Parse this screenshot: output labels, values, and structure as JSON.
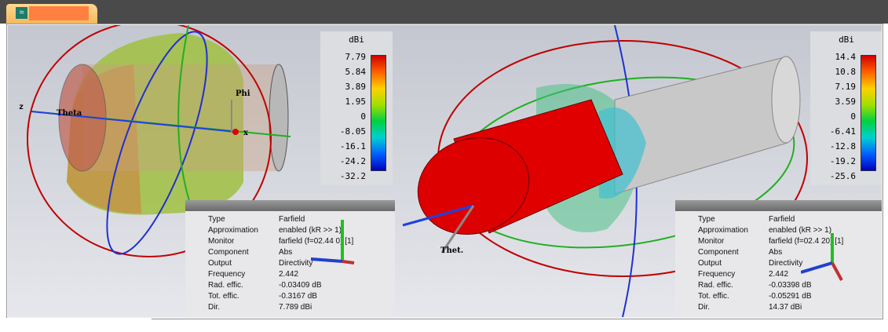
{
  "tab": {
    "icon": "wave-icon"
  },
  "views": [
    {
      "colorbar": {
        "unit": "dBi",
        "ticks": [
          "7.79",
          "5.84",
          "3.89",
          "1.95",
          "0",
          "-8.05",
          "-16.1",
          "-24.2",
          "-32.2"
        ]
      },
      "axis_labels": {
        "theta": "Theta",
        "phi": "Phi",
        "z": "z",
        "x": "x"
      },
      "info": [
        [
          "Type",
          "Farfield"
        ],
        [
          "Approximation",
          "enabled (kR >> 1)"
        ],
        [
          "Monitor",
          "farfield (f=02.44 0) [1]"
        ],
        [
          "Component",
          "Abs"
        ],
        [
          "Output",
          "Directivity"
        ],
        [
          "Frequency",
          "2.442"
        ],
        [
          "Rad. effic.",
          "-0.03409 dB"
        ],
        [
          "Tot. effic.",
          "-0.3167 dB"
        ],
        [
          "Dir.",
          "7.789 dBi"
        ]
      ]
    },
    {
      "colorbar": {
        "unit": "dBi",
        "ticks": [
          "14.4",
          "10.8",
          "7.19",
          "3.59",
          "0",
          "-6.41",
          "-12.8",
          "-19.2",
          "-25.6"
        ]
      },
      "axis_labels": {
        "theta": "Thet."
      },
      "info": [
        [
          "Type",
          "Farfield"
        ],
        [
          "Approximation",
          "enabled (kR >> 1)"
        ],
        [
          "Monitor",
          "farfield (f=02.4 20) [1]"
        ],
        [
          "Component",
          "Abs"
        ],
        [
          "Output",
          "Directivity"
        ],
        [
          "Frequency",
          "2.442"
        ],
        [
          "Rad. effic.",
          "-0.03398 dB"
        ],
        [
          "Tot. effic.",
          "-0.05291 dB"
        ],
        [
          "Dir.",
          "14.37 dBi"
        ]
      ]
    }
  ]
}
